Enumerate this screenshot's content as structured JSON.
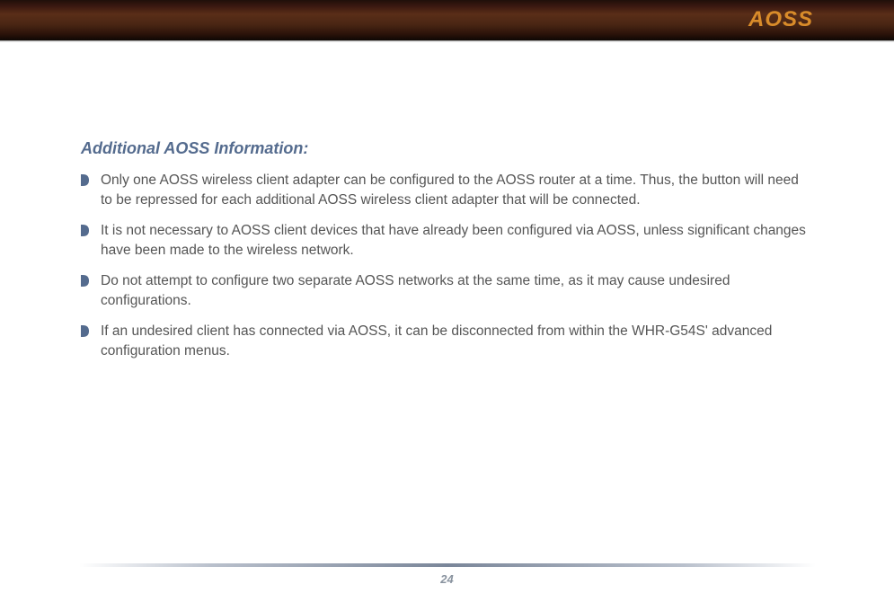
{
  "header": {
    "title": "AOSS"
  },
  "section": {
    "heading": "Additional AOSS Information:",
    "bullets": [
      "Only one AOSS wireless client adapter can be configured to the AOSS router at a time.  Thus, the button will need to be repressed for each additional AOSS wireless client adapter that will be connected.",
      "It is not necessary to AOSS client devices that have already been configured via AOSS, unless significant changes have been made to the wireless network.",
      "Do not attempt to configure two separate AOSS networks at the same time, as it may cause undesired configurations.",
      "If an undesired client has connected via AOSS, it can be disconnected from within the WHR-G54S' advanced configuration menus."
    ]
  },
  "footer": {
    "page_number": "24"
  }
}
